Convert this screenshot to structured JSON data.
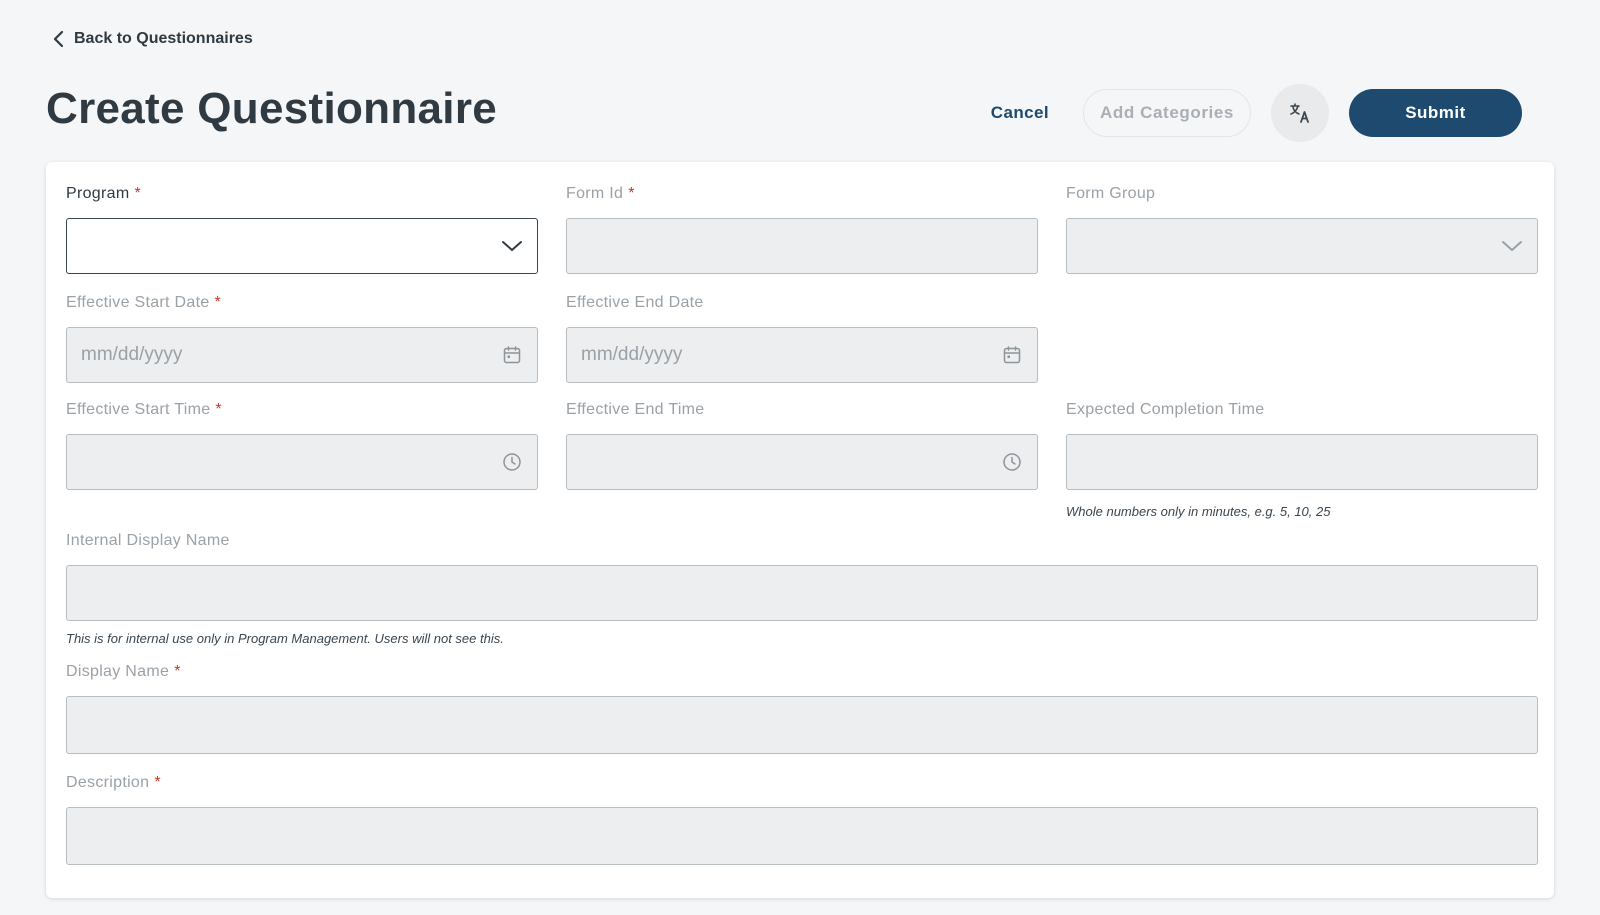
{
  "nav": {
    "back_label": "Back to Questionnaires"
  },
  "page": {
    "title": "Create Questionnaire"
  },
  "actions": {
    "cancel_label": "Cancel",
    "add_categories_label": "Add Categories",
    "submit_label": "Submit"
  },
  "form": {
    "program": {
      "label": "Program",
      "required": "*"
    },
    "form_id": {
      "label": "Form Id",
      "required": "*"
    },
    "form_group": {
      "label": "Form Group"
    },
    "start_date": {
      "label": "Effective Start Date",
      "required": "*",
      "placeholder": "mm/dd/yyyy"
    },
    "end_date": {
      "label": "Effective End Date",
      "placeholder": "mm/dd/yyyy"
    },
    "start_time": {
      "label": "Effective Start Time",
      "required": "*"
    },
    "end_time": {
      "label": "Effective End Time"
    },
    "completion_time": {
      "label": "Expected Completion Time",
      "hint": "Whole numbers only in minutes, e.g. 5, 10, 25"
    },
    "internal_name": {
      "label": "Internal Display Name",
      "hint": "This is for internal use only in Program Management. Users will not see this."
    },
    "display_name": {
      "label": "Display Name",
      "required": "*"
    },
    "description": {
      "label": "Description",
      "required": "*"
    }
  },
  "colors": {
    "primary": "#1d4a6e",
    "required": "#c0392b",
    "field_bg": "#eceeef"
  }
}
